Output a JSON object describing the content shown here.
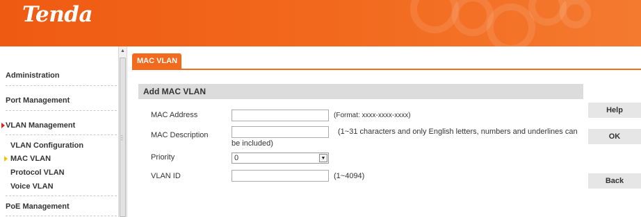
{
  "header": {
    "logo": "Tenda"
  },
  "sidebar": {
    "items": [
      {
        "label": "Administration"
      },
      {
        "label": "Port Management"
      },
      {
        "label": "VLAN Management"
      },
      {
        "label": "PoE Management"
      }
    ],
    "vlan_subitems": [
      {
        "label": "VLAN Configuration"
      },
      {
        "label": "MAC VLAN"
      },
      {
        "label": "Protocol VLAN"
      },
      {
        "label": "Voice VLAN"
      }
    ]
  },
  "tab": {
    "label": "MAC VLAN"
  },
  "section": {
    "title": "Add MAC VLAN"
  },
  "form": {
    "mac_address": {
      "label": "MAC Address",
      "value": "",
      "hint": "(Format: xxxx-xxxx-xxxx)"
    },
    "mac_description": {
      "label": "MAC Description",
      "value": "",
      "hint_line1": "(1~31 characters and only English letters, numbers and underlines can",
      "hint_line2": "be included)"
    },
    "priority": {
      "label": "Priority",
      "value": "0"
    },
    "vlan_id": {
      "label": "VLAN ID",
      "value": "",
      "hint": "(1~4094)"
    }
  },
  "buttons": {
    "help": "Help",
    "ok": "OK",
    "back": "Back"
  },
  "colors": {
    "brand": "#f26a1e",
    "active_marker": "#f5c000",
    "section_marker": "#d8261a"
  }
}
